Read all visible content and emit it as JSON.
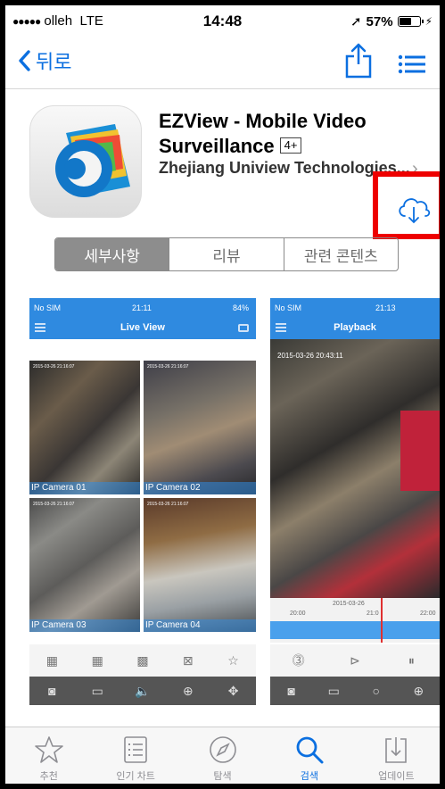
{
  "status": {
    "carrier": "olleh",
    "network": "LTE",
    "time": "14:48",
    "battery": "57%"
  },
  "nav": {
    "back_label": "뒤로"
  },
  "app": {
    "title": "EZView - Mobile Video Surveillance",
    "age_rating": "4+",
    "developer": "Zhejiang Uniview Technologies..."
  },
  "segments": [
    "세부사항",
    "리뷰",
    "관련 콘텐츠"
  ],
  "screenshot1": {
    "carrier": "No SIM",
    "time": "21:11",
    "battery": "84%",
    "title": "Live View",
    "stamp": "2015-03-26 21:16:07",
    "cameras": [
      "IP Camera 01",
      "IP Camera 02",
      "IP Camera 03",
      "IP Camera 04"
    ]
  },
  "screenshot2": {
    "carrier": "No SIM",
    "time": "21:13",
    "title": "Playback",
    "timestamp": "2015-03-26 20:43:11",
    "timeline_date": "2015-03-26",
    "timeline_ticks": [
      "20:00",
      "21:0",
      "22:00"
    ]
  },
  "tabs": [
    {
      "label": "추천",
      "icon": "star-icon"
    },
    {
      "label": "인기 차트",
      "icon": "list-icon"
    },
    {
      "label": "탐색",
      "icon": "compass-icon"
    },
    {
      "label": "검색",
      "icon": "search-icon"
    },
    {
      "label": "업데이트",
      "icon": "update-icon"
    }
  ],
  "colors": {
    "accent": "#0b6fe0",
    "highlight": "#ee0000",
    "app_blue": "#2f8ae0"
  },
  "active_tab": 3
}
